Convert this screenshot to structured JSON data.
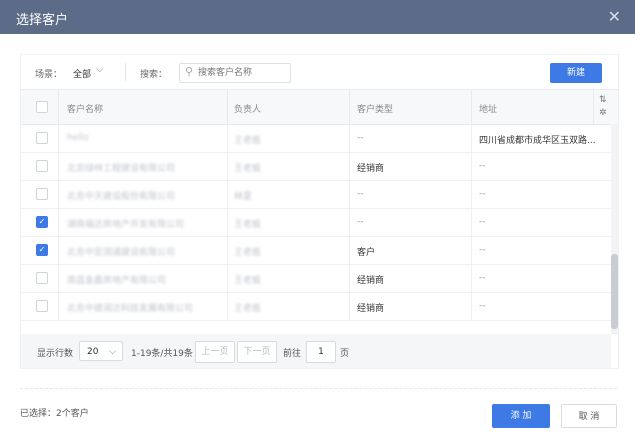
{
  "dialog": {
    "title": "选择客户",
    "close_icon": "close-icon"
  },
  "toolbar": {
    "scene_label": "场景：",
    "scene_value": "全部",
    "search_label": "搜索：",
    "search_placeholder": "搜索客户名称",
    "new_button": "新建"
  },
  "table": {
    "columns": [
      "客户名称",
      "负责人",
      "客户类型",
      "地址"
    ],
    "rows": [
      {
        "checked": false,
        "name": "hello",
        "owner": "王老板",
        "type": "--",
        "address": "四川省成都市成华区玉双路..."
      },
      {
        "checked": false,
        "name": "北京绿林工程建设有限公司",
        "owner": "王老板",
        "type": "经销商",
        "address": "--"
      },
      {
        "checked": false,
        "name": "北京中天建设股份有限公司",
        "owner": "林夏",
        "type": "--",
        "address": "--"
      },
      {
        "checked": true,
        "name": "湖南福达房地产开发有限公司",
        "owner": "王老板",
        "type": "--",
        "address": "--"
      },
      {
        "checked": true,
        "name": "北京中宏润通建设有限公司",
        "owner": "王老板",
        "type": "客户",
        "address": "--"
      },
      {
        "checked": false,
        "name": "南昌金鑫房地产有限公司",
        "owner": "王老板",
        "type": "经销商",
        "address": "--"
      },
      {
        "checked": false,
        "name": "北京中建润达科技发展有限公司",
        "owner": "王老板",
        "type": "经销商",
        "address": "--"
      }
    ]
  },
  "pager": {
    "rows_label": "显示行数",
    "page_size": "20",
    "range": "1-19条/共19条",
    "prev": "上一页",
    "next": "下一页",
    "goto_label": "前往",
    "page": "1",
    "page_suffix": "页"
  },
  "footer": {
    "selected": "已选择：2个客户",
    "add": "添 加",
    "cancel": "取 消"
  },
  "colors": {
    "titlebar": "#5c6b87",
    "primary": "#3d7ae6"
  }
}
